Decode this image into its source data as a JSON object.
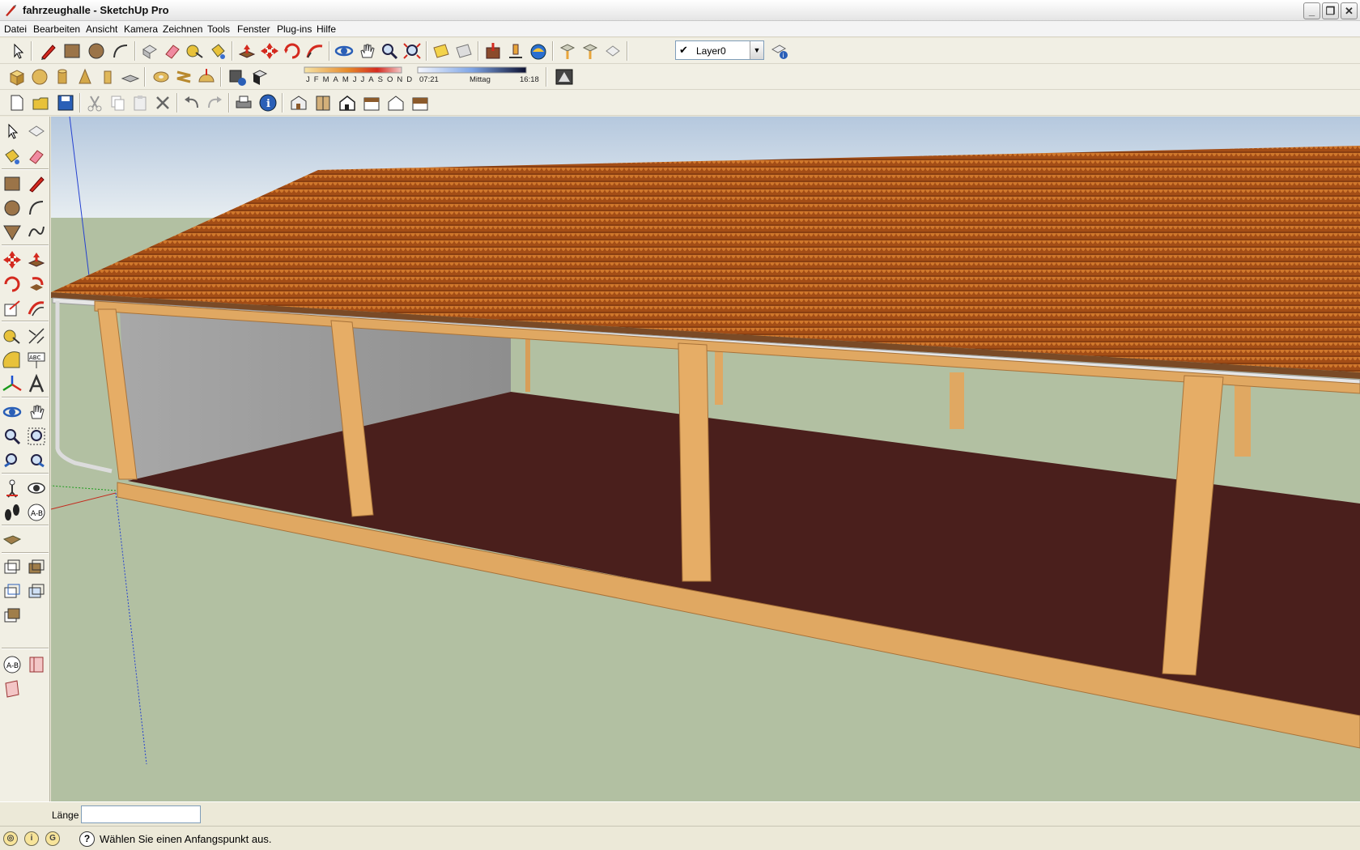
{
  "window": {
    "title": "fahrzeughalle - SketchUp Pro"
  },
  "menu": [
    "Datei",
    "Bearbeiten",
    "Ansicht",
    "Kamera",
    "Zeichnen",
    "Tools",
    "Fenster",
    "Plug-ins",
    "Hilfe"
  ],
  "layers": {
    "current": "Layer0",
    "checked": true
  },
  "shadow_settings": {
    "months": [
      "J",
      "F",
      "M",
      "A",
      "M",
      "J",
      "J",
      "A",
      "S",
      "O",
      "N",
      "D"
    ],
    "sunrise": "07:21",
    "noon": "Mittag",
    "sunset": "16:18"
  },
  "measurements": {
    "label": "Länge",
    "value": ""
  },
  "status": {
    "message": "Wählen Sie einen Anfangspunkt aus."
  },
  "colors": {
    "roof": "#b3571a",
    "ground": "#b2c0a2",
    "floor": "#4a1f1c",
    "timber": "#e0a862",
    "wall": "#9a9a9a",
    "sky_top": "#b6c9e0"
  }
}
